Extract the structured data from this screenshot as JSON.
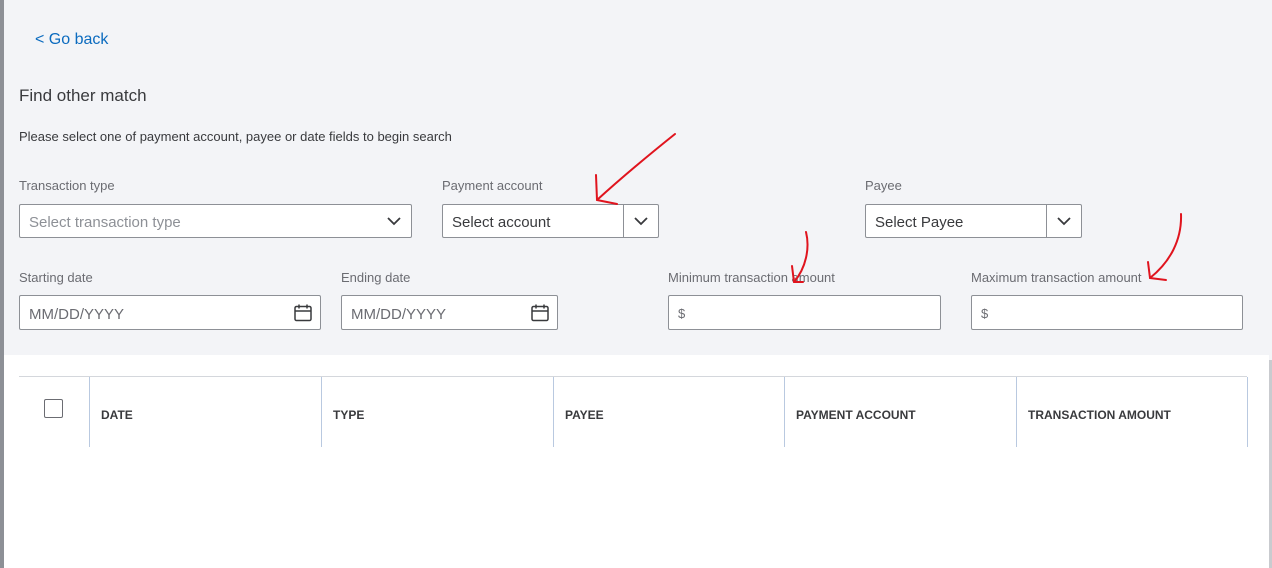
{
  "nav": {
    "go_back": "< Go back"
  },
  "page": {
    "title": "Find other match",
    "instructions": "Please select one of payment account, payee or date fields to begin search"
  },
  "filters": {
    "transaction_type": {
      "label": "Transaction type",
      "placeholder": "Select transaction type"
    },
    "payment_account": {
      "label": "Payment account",
      "placeholder": "Select account"
    },
    "payee": {
      "label": "Payee",
      "placeholder": "Select Payee"
    },
    "starting_date": {
      "label": "Starting date",
      "placeholder": "MM/DD/YYYY"
    },
    "ending_date": {
      "label": "Ending date",
      "placeholder": "MM/DD/YYYY"
    },
    "min_amount": {
      "label": "Minimum transaction amount",
      "currency": "$"
    },
    "max_amount": {
      "label": "Maximum transaction amount",
      "currency": "$"
    }
  },
  "table": {
    "columns": [
      "DATE",
      "TYPE",
      "PAYEE",
      "PAYMENT ACCOUNT",
      "TRANSACTION AMOUNT"
    ]
  },
  "colors": {
    "link": "#0b6bbf",
    "annotation": "#e0141e",
    "border": "#8d9096"
  }
}
